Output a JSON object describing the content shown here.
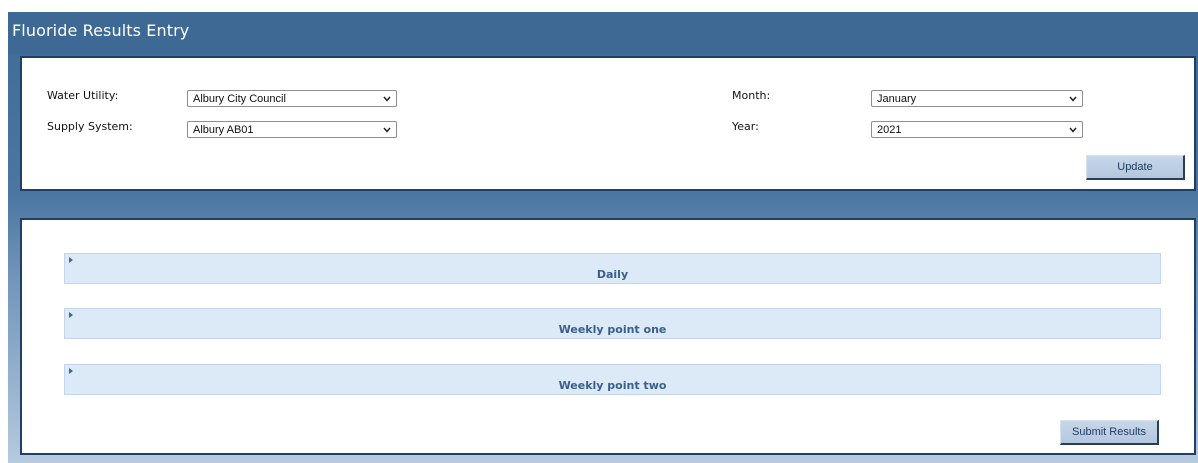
{
  "header": {
    "title": "Fluoride Results Entry"
  },
  "filters": {
    "water_utility_label": "Water Utility:",
    "water_utility_value": "Albury City Council",
    "supply_system_label": "Supply System:",
    "supply_system_value": "Albury AB01",
    "month_label": "Month:",
    "month_value": "January",
    "year_label": "Year:",
    "year_value": "2021",
    "update_label": "Update"
  },
  "sections": {
    "items": [
      {
        "title": "Daily"
      },
      {
        "title": "Weekly point one"
      },
      {
        "title": "Weekly point two"
      }
    ],
    "submit_label": "Submit Results"
  },
  "colors": {
    "header_bg": "#3d6994",
    "panel_border": "#1f3f66",
    "accordion_bg": "#dce9f7",
    "accordion_text": "#3a5f8c",
    "button_bg": "#b3c7df"
  },
  "icons": {
    "dropdown": "chevron-down-icon",
    "accordion": "triangle-right-icon"
  }
}
